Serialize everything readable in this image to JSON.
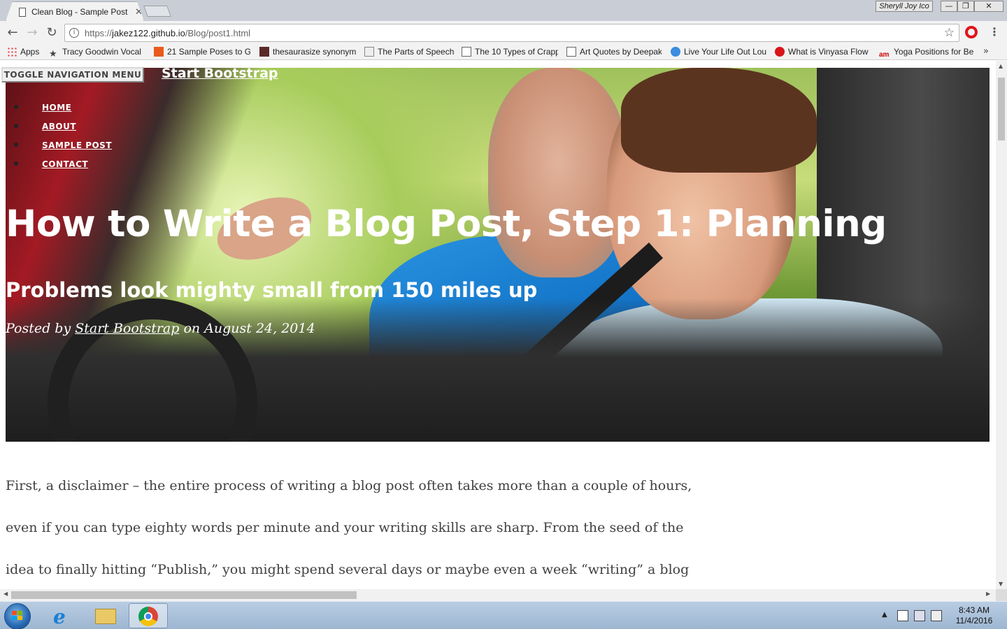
{
  "browser": {
    "tab_title": "Clean Blog - Sample Post",
    "tab_close": "✕",
    "profile_name": "Sheryll Joy Ico",
    "url_prefix": "https://",
    "url_host": "jakez122.github.io",
    "url_path": "/Blog/post1.html",
    "window_min": "—",
    "window_max": "❐",
    "window_close": "✕"
  },
  "bookmarks": [
    {
      "label": "Apps",
      "icon": "apps-grid-icon"
    },
    {
      "label": "Tracy Goodwin Vocal",
      "icon": "star-icon"
    },
    {
      "label": "21 Sample Poses to G",
      "icon": "site-icon"
    },
    {
      "label": "thesaurasize synonym",
      "icon": "site-icon"
    },
    {
      "label": "The Parts of Speech",
      "icon": "site-icon"
    },
    {
      "label": "The 10 Types of Crapp",
      "icon": "page-icon"
    },
    {
      "label": "Art Quotes by Deepak",
      "icon": "page-icon"
    },
    {
      "label": "Live Your Life Out Lou",
      "icon": "site-icon"
    },
    {
      "label": "What is Vinyasa Flow",
      "icon": "site-icon"
    },
    {
      "label": "Yoga Positions for Be",
      "icon": "site-icon"
    }
  ],
  "page": {
    "toggle_label": "TOGGLE NAVIGATION MENU",
    "brand": "Start Bootstrap",
    "nav": [
      "HOME",
      "ABOUT",
      "SAMPLE POST",
      "CONTACT"
    ],
    "title": "How to Write a Blog Post, Step 1: Planning",
    "subtitle": "Problems look mighty small from 150 miles up",
    "meta_prefix": "Posted by ",
    "meta_author": "Start Bootstrap",
    "meta_suffix": " on August 24, 2014",
    "body_lines": [
      "First, a disclaimer – the entire process of writing a blog post often takes more than a couple of hours,",
      "even if you can type eighty words per minute and your writing skills are sharp. From the seed of the",
      "idea to finally hitting “Publish,” you might spend several days or maybe even a week “writing” a blog"
    ]
  },
  "taskbar": {
    "time": "8:43 AM",
    "date": "11/4/2016"
  },
  "colors": {
    "accent_link": "#ffffff",
    "opera_red": "#e0131a",
    "body_text": "#404040"
  }
}
